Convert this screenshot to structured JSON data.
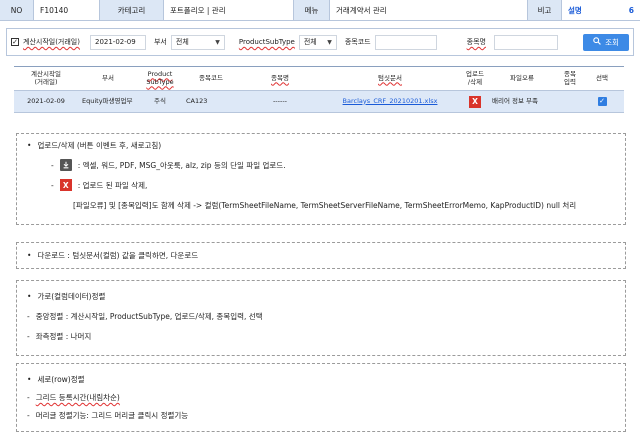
{
  "info_bar": {
    "no_label": "NO",
    "no_value": "F10140",
    "category_label": "카테고리",
    "category_value": "포트폴리오 | 관리",
    "menu_label": "메뉴",
    "menu_value": "거래계약서 관리",
    "remark_label": "비고",
    "remark_value": "설명",
    "remark_count": "6"
  },
  "filter": {
    "date_checkbox_label": "계산시작일(거래일)",
    "date_value": "2021-02-09",
    "dept_label": "부서",
    "dept_value": "전체",
    "subtype_label": "ProductSubType",
    "subtype_value": "전체",
    "code_label": "종목코드",
    "code_value": "",
    "name_label": "종목명",
    "name_value": "",
    "search_label": "조회"
  },
  "grid": {
    "headers": {
      "calc_date": "계산시작일\n(거래일)",
      "dept": "부서",
      "product": "Product\nSubType",
      "code": "종목코드",
      "name": "종목명",
      "termsheet": "텀싯문서",
      "upload": "업로드\n/삭제",
      "file_error": "파일오류",
      "item_input": "종목\n입력",
      "select": "선택"
    },
    "rows": [
      {
        "calc_date": "2021-02-09",
        "dept": "Equity파생영업부",
        "product": "주식",
        "code": "CA123",
        "name": "------",
        "termsheet": "Barclays_CRF_20210201.xlsx",
        "upload": "X",
        "file_error": "배리어 정보 부족",
        "item_input": "",
        "selected": true
      }
    ]
  },
  "notes": {
    "upload": {
      "title": "업로드/삭제 (버튼 이벤트 후, 새로고침)",
      "upload_desc": ": 엑셀, 워드, PDF, MSG_아웃룩, alz, zip 등의 단일 파일 업로드.",
      "delete_desc": ": 업로드 된 파일 삭제,",
      "delete_detail": "[파일오류] 및 [종목입력]도 함께 삭제 -> 컬럼(TermSheetFileName, TermSheetServerFileName, TermSheetErrorMemo, KapProductID) null 처리",
      "delete_icon": "X"
    },
    "download": {
      "text": "다운로드 : 텀싯문서(컬럼) 값을 클릭하면, 다운로드"
    },
    "align": {
      "title": "가로(컬럼데이터)정렬",
      "center": "중앙정렬 : 계산시작일, ProductSubType, 업로드/삭제, 종목입력, 선택",
      "left": "좌측정렬 : 나머지"
    },
    "sort": {
      "title": "세로(row)정렬",
      "grid_sort": "그리드 등록시간(내림차순)",
      "header_sort": "머리글 정렬기능: 그리드 머리글 클릭시 정렬기능"
    }
  },
  "colors": {
    "accent": "#1a5bd8",
    "header_bg": "#dce7f5",
    "row_selected": "#dde8f7",
    "search_button": "#3d8ae6",
    "delete_red": "#d9342b"
  },
  "icons": [
    "check-icon",
    "caret-down-icon",
    "search-icon",
    "download-icon",
    "delete-x-icon",
    "checkbox-checked-icon"
  ]
}
